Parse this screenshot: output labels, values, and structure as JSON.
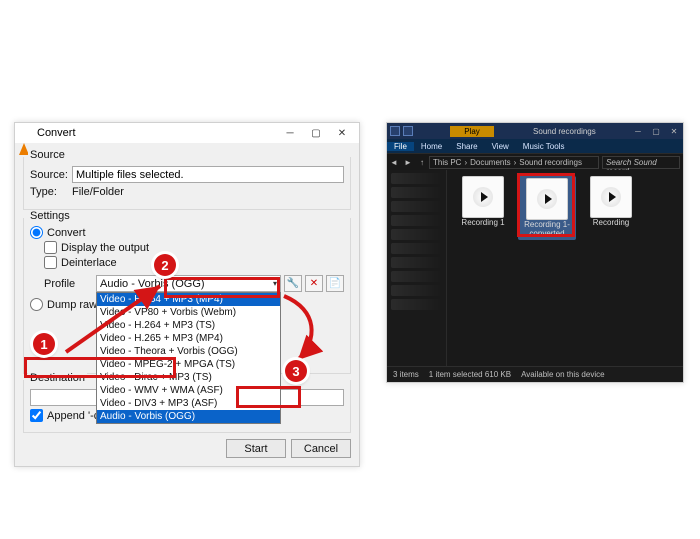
{
  "convert": {
    "title": "Convert",
    "source_section": "Source",
    "source_label": "Source:",
    "source_value": "Multiple files selected.",
    "type_label": "Type:",
    "type_value": "File/Folder",
    "settings_section": "Settings",
    "convert_radio": "Convert",
    "display_output": "Display the output",
    "deinterlace": "Deinterlace",
    "profile_label": "Profile",
    "profile_selected": "Audio - Vorbis (OGG)",
    "profile_options": [
      "Video - H.264 + MP3 (MP4)",
      "Video - VP80 + Vorbis (Webm)",
      "Video - H.264 + MP3 (TS)",
      "Video - H.265 + MP3 (MP4)",
      "Video - Theora + Vorbis (OGG)",
      "Video - MPEG-2 + MPGA (TS)",
      "Video - Dirac + MP3 (TS)",
      "Video - WMV + WMA (ASF)",
      "Video - DIV3 + MP3 (ASF)",
      "Audio - Vorbis (OGG)"
    ],
    "dump_raw": "Dump raw input",
    "dest_section": "Destination",
    "append_label": "Append '-converted' to filename",
    "start": "Start",
    "cancel": "Cancel",
    "tool_edit_icon": "wrench-icon",
    "tool_delete_icon": "x-icon",
    "tool_new_icon": "new-icon"
  },
  "explorer": {
    "play_tab": "Play",
    "title": "Sound recordings",
    "menu": [
      "File",
      "Home",
      "Share",
      "View",
      "Music Tools"
    ],
    "path": [
      "This PC",
      "Documents",
      "Sound recordings"
    ],
    "search_placeholder": "Search Sound record…",
    "files": [
      {
        "name": "Recording 1"
      },
      {
        "name": "Recording 1-converted"
      },
      {
        "name": "Recording"
      }
    ],
    "status_items": "3 items",
    "status_selected": "1 item selected  610 KB",
    "status_avail": "Available on this device"
  },
  "callouts": {
    "b1": "1",
    "b2": "2",
    "b3": "3"
  }
}
